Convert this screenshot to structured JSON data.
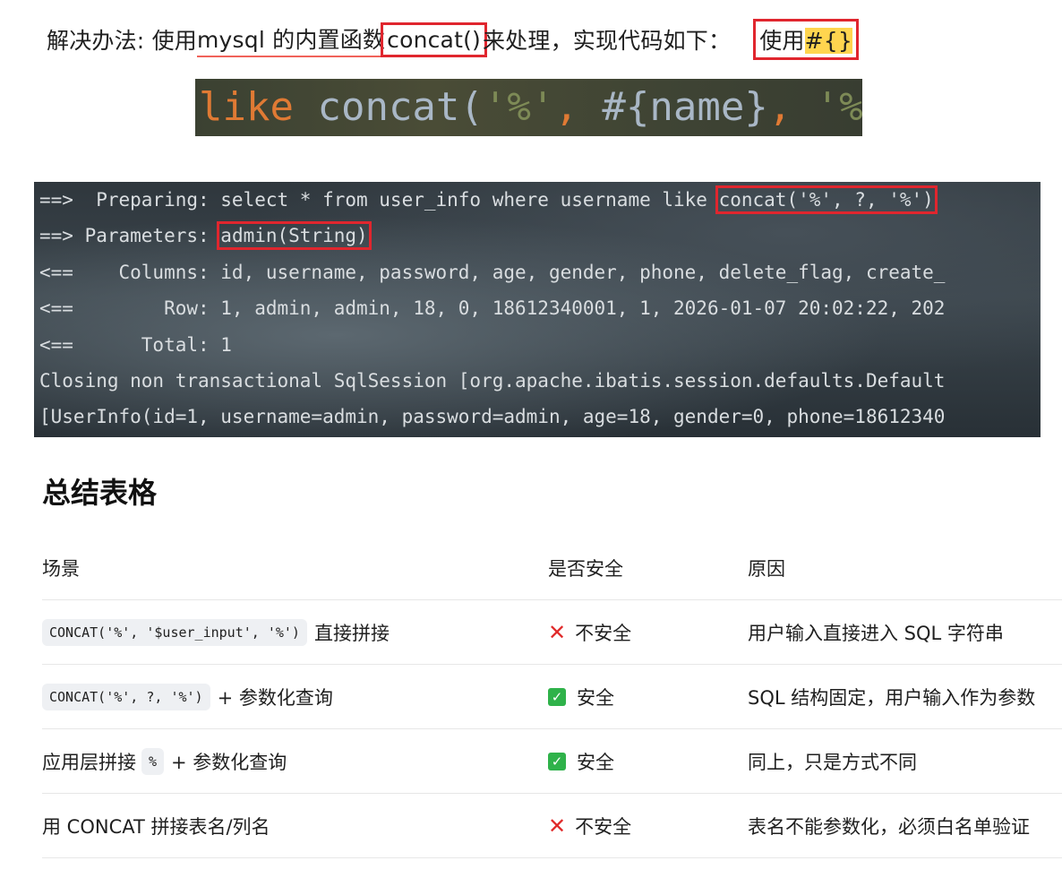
{
  "intro": {
    "part1": "解决办法: 使用",
    "part2": " mysql 的内置函数",
    "func": "concat()",
    "part3": "来处理，实现代码如下：",
    "use_label": "使用",
    "placeholder": "#{}"
  },
  "banner": {
    "keyword": "like",
    "fn": "concat(",
    "arg1": "'%'",
    "comma1": ", ",
    "arg2": "#{name}",
    "comma2": ", ",
    "arg3": "'%'",
    "close": ")"
  },
  "console": {
    "line1_prefix": "==>  Preparing: select * from user_info where username like ",
    "line1_boxed": "concat('%', ?, '%')",
    "line2_prefix": "==> Parameters: ",
    "line2_boxed": "admin(String)",
    "line3": "<==    Columns: id, username, password, age, gender, phone, delete_flag, create_",
    "line4": "<==        Row: 1, admin, admin, 18, 0, 18612340001, 1, 2026-01-07 20:02:22, 202",
    "line5": "<==      Total: 1",
    "line6": "Closing non transactional SqlSession [org.apache.ibatis.session.defaults.Default",
    "line7": "[UserInfo(id=1, username=admin, password=admin, age=18, gender=0, phone=18612340"
  },
  "summary": {
    "heading": "总结表格",
    "headers": [
      "场景",
      "是否安全",
      "原因"
    ],
    "rows": [
      {
        "code": "CONCAT('%', '$user_input', '%')",
        "text": "直接拼接",
        "status": "不安全",
        "reason": "用户输入直接进入 SQL 字符串"
      },
      {
        "code": "CONCAT('%', ?, '%')",
        "text": "+ 参数化查询",
        "status": "安全",
        "reason": "SQL 结构固定，用户输入作为参数"
      },
      {
        "pre": "应用层拼接",
        "code": "%",
        "text": "+ 参数化查询",
        "status": "安全",
        "reason": "同上，只是方式不同"
      },
      {
        "text": "用 CONCAT 拼接表名/列名",
        "status": "不安全",
        "reason": "表名不能参数化，必须白名单验证"
      }
    ]
  },
  "colors": {
    "red_box": "#e0262e",
    "highlight": "#ffd54f",
    "safe_green": "#2fb24a",
    "unsafe_red": "#e02a2a"
  }
}
